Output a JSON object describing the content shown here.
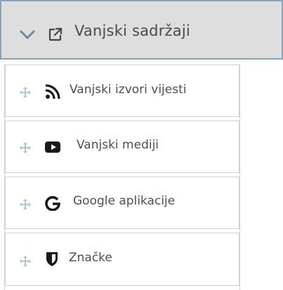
{
  "header": {
    "title": "Vanjski sadržaji",
    "toggle_icon": "chevron-down-icon",
    "icon": "external-link-icon"
  },
  "items": [
    {
      "label": "Vanjski izvori vijesti",
      "icon": "rss-icon"
    },
    {
      "label": "Vanjski mediji",
      "icon": "youtube-icon"
    },
    {
      "label": "Google aplikacije",
      "icon": "google-icon"
    },
    {
      "label": "Značke",
      "icon": "shield-icon"
    }
  ],
  "colors": {
    "header_bg": "#dedede",
    "header_border": "#7fa6c9",
    "icon_accent": "#1a1a1a",
    "drag_handle": "#a8c7d8",
    "text": "#4e4e4e"
  }
}
